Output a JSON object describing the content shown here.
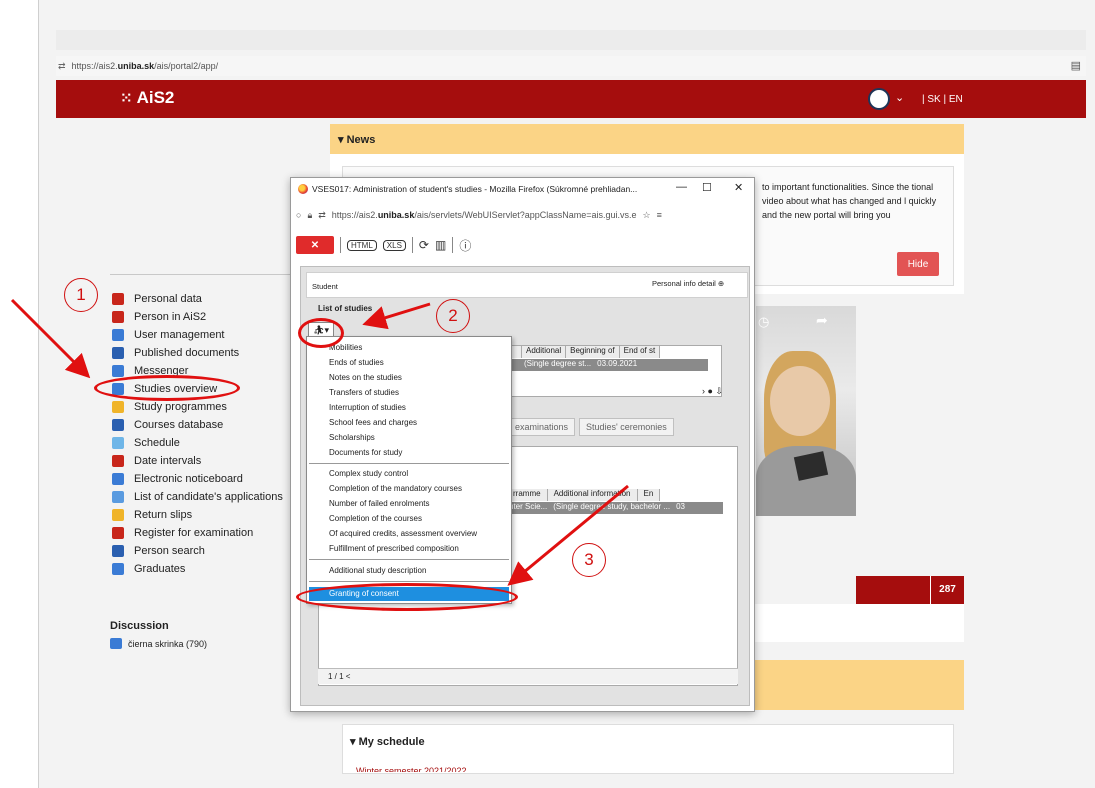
{
  "browser": {
    "url_scheme": "https://ais2.",
    "url_domain": "uniba.sk",
    "url_path": "/ais/portal2/app/"
  },
  "app": {
    "logo": "AiS2",
    "lang": "| SK | EN"
  },
  "sidebar": {
    "items": [
      {
        "label": "Personal data",
        "color": "#c8261b"
      },
      {
        "label": "Person in AiS2",
        "color": "#c8261b"
      },
      {
        "label": "User management",
        "color": "#3a7bd5"
      },
      {
        "label": "Published documents",
        "color": "#2a5fb0"
      },
      {
        "label": "Messenger",
        "color": "#3a7bd5"
      },
      {
        "label": "Studies overview",
        "color": "#3a7bd5"
      },
      {
        "label": "Study programmes",
        "color": "#f0b429"
      },
      {
        "label": "Courses database",
        "color": "#2a5fb0"
      },
      {
        "label": "Schedule",
        "color": "#6fb6e8"
      },
      {
        "label": "Date intervals",
        "color": "#c8261b"
      },
      {
        "label": "Electronic noticeboard",
        "color": "#3a7bd5"
      },
      {
        "label": "List of candidate's applications",
        "color": "#5a9be0"
      },
      {
        "label": "Return slips",
        "color": "#f0b429"
      },
      {
        "label": "Register for examination",
        "color": "#c8261b"
      },
      {
        "label": "Person search",
        "color": "#2a5fb0"
      },
      {
        "label": "Graduates",
        "color": "#3a7bd5"
      }
    ],
    "discussion_title": "Discussion",
    "discussion_item": "čierna skrinka (790)"
  },
  "news": {
    "title": "▾ News",
    "text": "to important functionalities. Since the tional video about what has changed and l quickly and the new portal will bring you",
    "hide_label": "Hide",
    "count": "287",
    "schedule_title": "▾ My schedule",
    "schedule_cut": "Winter semester 2021/2022"
  },
  "popup": {
    "title": "VSES017: Administration of student's studies - Mozilla Firefox (Súkromné prehliadan...",
    "url_scheme": "https://ais2.",
    "url_domain": "uniba.sk",
    "url_path": "/ais/servlets/WebUIServlet?appClassName=ais.gui.vs.e",
    "close_label": "✕",
    "html_label": "HTML",
    "xls_label": "XLS",
    "student_label": "Student",
    "personal_info_label": "Personal info detail",
    "list_of_studies": "List of studies",
    "grid1_headers": [
      "Additional",
      "Beginning of",
      "End of st"
    ],
    "grid1_row": [
      "(Single degree st...",
      "03.09.2021"
    ],
    "tabs": [
      "examinations",
      "Studies' ceremonies"
    ],
    "grid2_headers": [
      "rramme",
      "Additional information",
      "En"
    ],
    "grid2_row": [
      "uter Scie...",
      "(Single degree study, bachelor ...",
      "03"
    ],
    "pager": "1  /  1   <"
  },
  "menu": {
    "group1": [
      "Mobilities",
      "Ends of studies",
      "Notes on the studies",
      "Transfers of studies",
      "Interruption of studies",
      "School fees and charges",
      "Scholarships",
      "Documents for study"
    ],
    "group2": [
      "Complex study control",
      "Completion of the mandatory courses",
      "Number of failed enrolments",
      "Completion of the courses",
      "Of acquired credits, assessment overview",
      "Fulfillment of prescribed composition"
    ],
    "group3": [
      "Additional study description"
    ],
    "selected": "Granting of consent"
  },
  "annotations": {
    "step1": "1",
    "step2": "2",
    "step3": "3",
    "color": "#d01010"
  }
}
